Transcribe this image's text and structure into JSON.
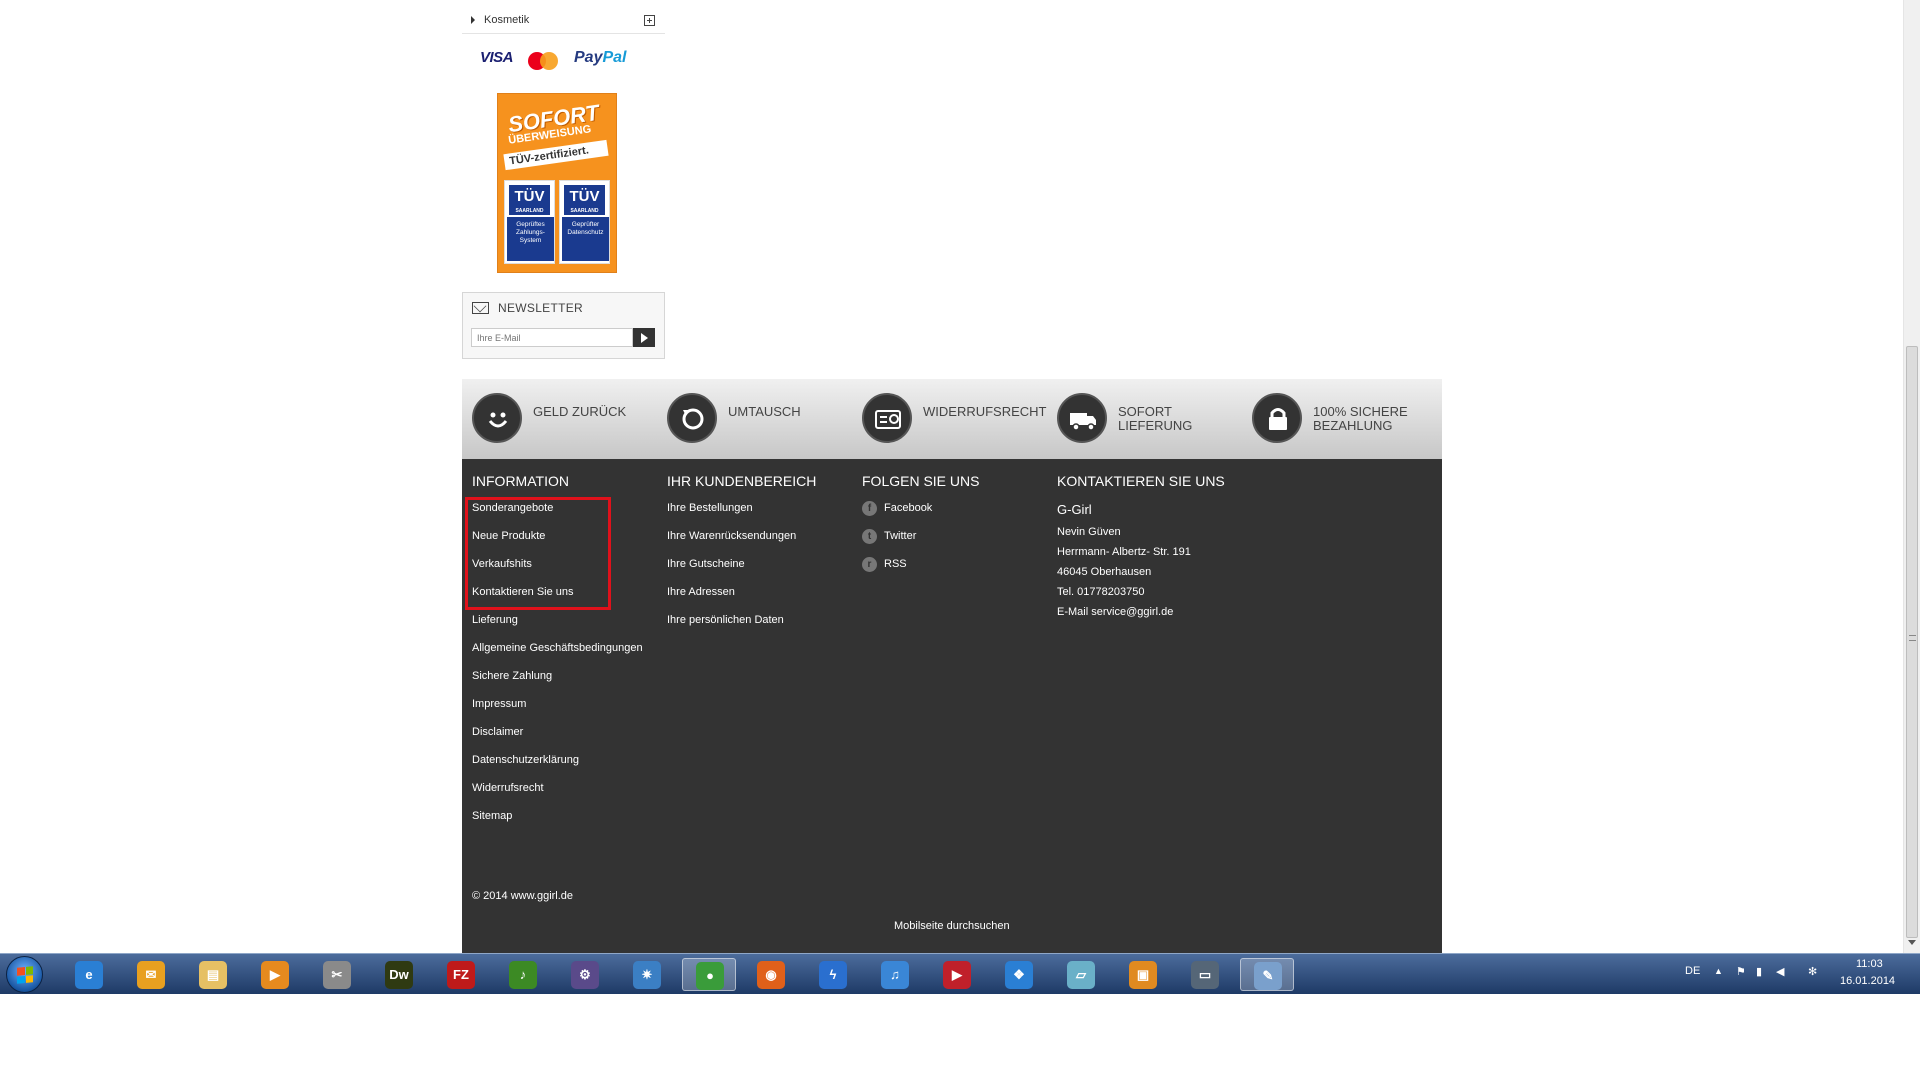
{
  "sidebar": {
    "category": "Kosmetik",
    "payments": {
      "visa": "VISA",
      "paypal_pay": "Pay",
      "paypal_pal": "Pal"
    },
    "sofort": {
      "title": "SOFORT",
      "subtitle": "ÜBERWEISUNG",
      "tag": "TÜV-zertifiziert.",
      "tuv_logo": "TÜV",
      "tuv_region": "SAARLAND",
      "box1": "Geprüftes Zahlungs-System",
      "box2": "Geprüfter Datenschutz"
    },
    "newsletter": {
      "title": "NEWSLETTER",
      "placeholder": "Ihre E-Mail"
    }
  },
  "features": [
    {
      "label": "GELD ZURÜCK",
      "icon": "smiley-icon"
    },
    {
      "label": "UMTAUSCH",
      "icon": "exchange-icon"
    },
    {
      "label": "WIDERRUFSRECHT",
      "icon": "document-icon"
    },
    {
      "label": "SOFORT LIEFERUNG",
      "icon": "truck-icon"
    },
    {
      "label": "100% SICHERE BEZAHLUNG",
      "icon": "lock-icon"
    }
  ],
  "footer": {
    "information": {
      "title": "INFORMATION",
      "links": [
        "Sonderangebote",
        "Neue Produkte",
        "Verkaufshits",
        "Kontaktieren Sie uns",
        "Lieferung",
        "Allgemeine Geschäftsbedingungen",
        "Sichere Zahlung",
        "Impressum",
        "Disclaimer",
        "Datenschutzerklärung",
        "Widerrufsrecht",
        "Sitemap"
      ]
    },
    "account": {
      "title": "IHR KUNDENBEREICH",
      "links": [
        "Ihre Bestellungen",
        "Ihre Warenrücksendungen",
        "Ihre Gutscheine",
        "Ihre Adressen",
        "Ihre persönlichen Daten"
      ]
    },
    "follow": {
      "title": "FOLGEN SIE UNS",
      "links": [
        {
          "label": "Facebook",
          "glyph": "f"
        },
        {
          "label": "Twitter",
          "glyph": "t"
        },
        {
          "label": "RSS",
          "glyph": "r"
        }
      ]
    },
    "contact": {
      "title": "KONTAKTIEREN SIE UNS",
      "brand": "G-Girl",
      "lines": [
        "Nevin Güven",
        "Herrmann- Albertz- Str. 191",
        "46045 Oberhausen",
        "Tel. 01778203750",
        "E-Mail service@ggirl.de"
      ]
    },
    "copyright": "© 2014 www.ggirl.de",
    "mobile": "Mobilseite durchsuchen"
  },
  "taskbar": {
    "language": "DE",
    "time": "11:03",
    "date": "16.01.2014",
    "apps": [
      {
        "name": "internet-explorer",
        "glyph": "e",
        "color": "#2a7fd4"
      },
      {
        "name": "outlook",
        "glyph": "✉",
        "color": "#e8a020"
      },
      {
        "name": "file-explorer",
        "glyph": "▤",
        "color": "#e6c064"
      },
      {
        "name": "media-player",
        "glyph": "▶",
        "color": "#e68a1e"
      },
      {
        "name": "tools",
        "glyph": "✂",
        "color": "#8a8a8a"
      },
      {
        "name": "dreamweaver",
        "glyph": "Dw",
        "color": "#2f3a12"
      },
      {
        "name": "filezilla",
        "glyph": "FZ",
        "color": "#bf1a1a"
      },
      {
        "name": "app-green",
        "glyph": "♪",
        "color": "#3c8a24"
      },
      {
        "name": "app-purple",
        "glyph": "⚙",
        "color": "#5a4a8a"
      },
      {
        "name": "safari",
        "glyph": "✷",
        "color": "#3b7fc4"
      },
      {
        "name": "chrome",
        "glyph": "●",
        "color": "#3a9c3a"
      },
      {
        "name": "firefox",
        "glyph": "◉",
        "color": "#e0601a"
      },
      {
        "name": "app-blue",
        "glyph": "ϟ",
        "color": "#2a6fcf"
      },
      {
        "name": "itunes",
        "glyph": "♫",
        "color": "#3a86d6"
      },
      {
        "name": "app-red",
        "glyph": "▶",
        "color": "#c0202a"
      },
      {
        "name": "dropbox",
        "glyph": "❖",
        "color": "#2a7fd4"
      },
      {
        "name": "app-notes",
        "glyph": "▱",
        "color": "#6ab0c8"
      },
      {
        "name": "app-docs",
        "glyph": "▣",
        "color": "#e08a20"
      },
      {
        "name": "app-laptop",
        "glyph": "▭",
        "color": "#556677"
      },
      {
        "name": "paint",
        "glyph": "✎",
        "color": "#7aa0cc"
      }
    ]
  }
}
